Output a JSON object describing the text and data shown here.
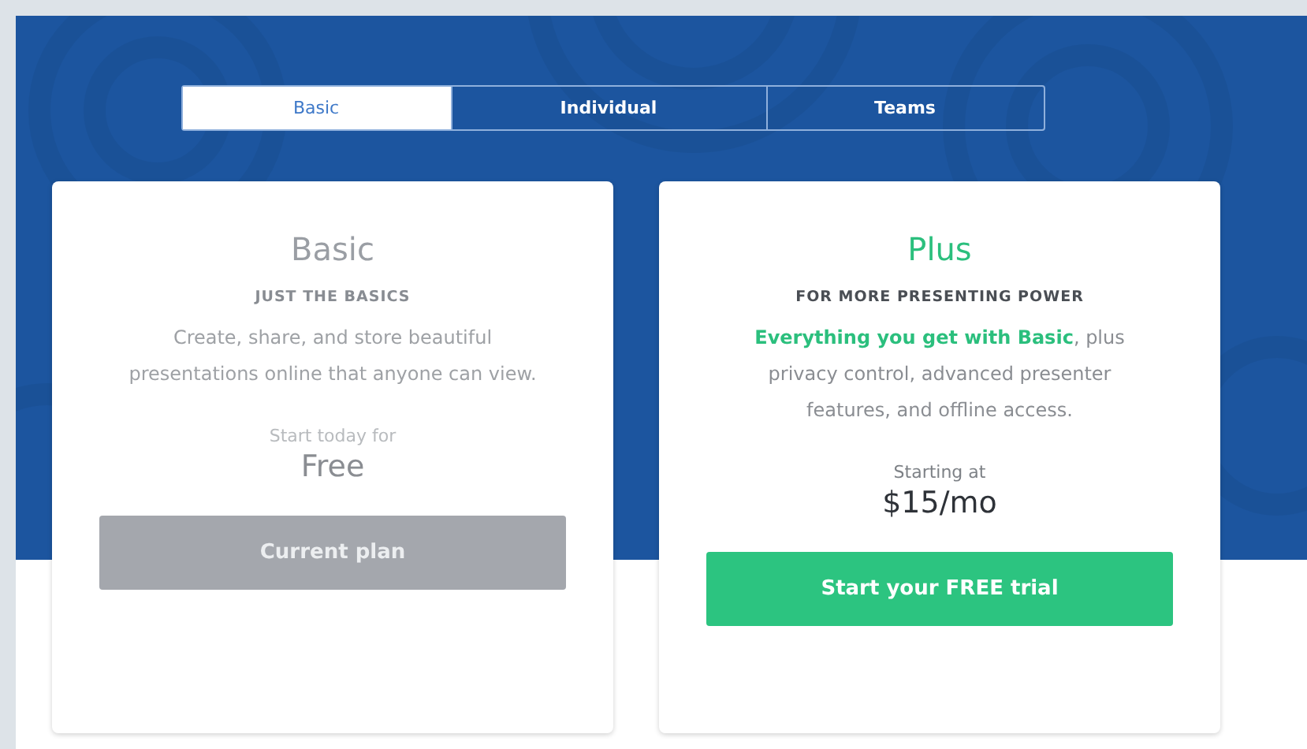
{
  "tabs": [
    {
      "label": "Basic",
      "selected": true
    },
    {
      "label": "Individual",
      "selected": false
    },
    {
      "label": "Teams",
      "selected": false
    }
  ],
  "plans": [
    {
      "name": "Basic",
      "current": true,
      "tagline": "JUST THE BASICS",
      "description": "Create, share, and store beautiful presentations online that anyone can view.",
      "price_label": "Start today for",
      "price": "Free",
      "button": "Current plan"
    },
    {
      "name": "Plus",
      "current": false,
      "tagline": "FOR MORE PRESENTING POWER",
      "description": "**Everything you get with Basic**, plus privacy control, advanced presenter features, and offline access.",
      "price_label": "Starting at",
      "price": "$15/mo",
      "button": "Start your FREE trial"
    }
  ]
}
